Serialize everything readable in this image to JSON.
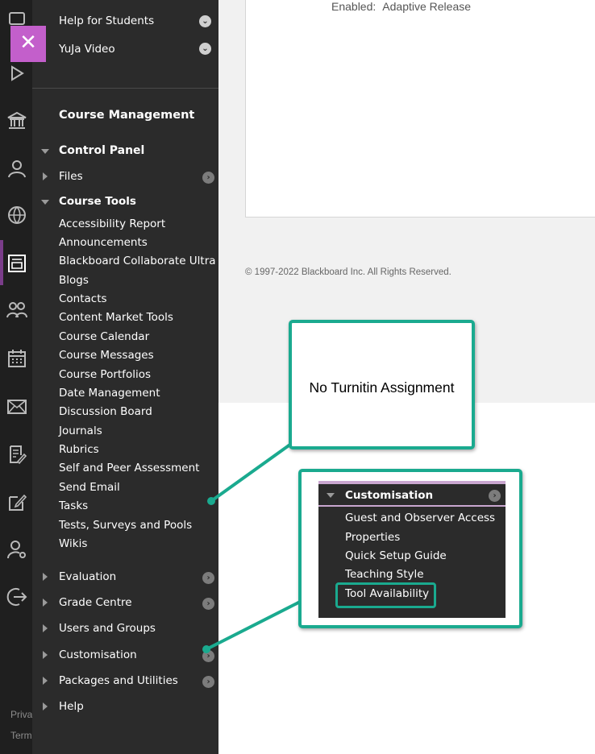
{
  "colors": {
    "menu_bg": "#2b2b2b",
    "rail_bg": "#1f1f1f",
    "accent_purple": "#c35fcb",
    "callout_border": "#1aaa8f"
  },
  "rail": {
    "icons": [
      "institution-icon",
      "user-icon",
      "globe-icon",
      "courses-icon",
      "people-icon",
      "calendar-icon",
      "mail-icon",
      "grades-icon",
      "edit-icon",
      "user-settings-icon",
      "sign-out-icon"
    ],
    "footer": [
      "Priva",
      "Term"
    ]
  },
  "close_label": "✕",
  "menu": {
    "top_links": [
      {
        "label": "Help for Students"
      },
      {
        "label": "YuJa Video"
      }
    ],
    "section_title": "Course Management",
    "control_panel": "Control Panel",
    "files": "Files",
    "course_tools": "Course Tools",
    "tools": [
      "Accessibility Report",
      "Announcements",
      "Blackboard Collaborate Ultra",
      "Blogs",
      "Contacts",
      "Content Market Tools",
      "Course Calendar",
      "Course Messages",
      "Course Portfolios",
      "Date Management",
      "Discussion Board",
      "Journals",
      "Rubrics",
      "Self and Peer Assessment",
      "Send Email",
      "Tasks",
      "Tests, Surveys and Pools",
      "Wikis"
    ],
    "groups": [
      "Evaluation",
      "Grade Centre",
      "Users and Groups",
      "Customisation",
      "Packages and Utilities",
      "Help"
    ]
  },
  "content": {
    "enabled_label": "Enabled:",
    "enabled_value": "Adaptive Release",
    "copyright": "© 1997-2022 Blackboard Inc. All Rights Reserved."
  },
  "callouts": {
    "first_text": "No Turnitin Assignment",
    "inset": {
      "title": "Customisation",
      "items": [
        "Guest and Observer Access",
        "Properties",
        "Quick Setup Guide",
        "Teaching Style",
        "Tool Availability"
      ]
    }
  }
}
